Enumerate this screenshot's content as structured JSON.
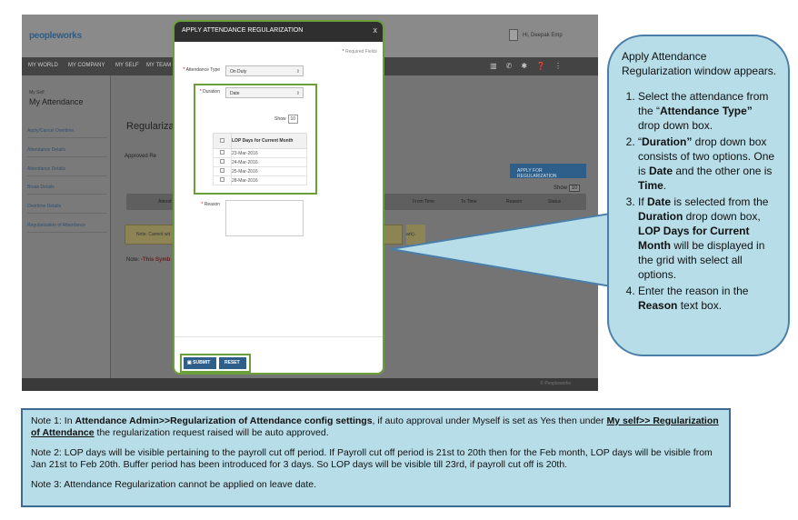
{
  "app": {
    "logo": "peopleworks",
    "user_name": "Hi, Deepak Emp",
    "nav": [
      "MY WORLD",
      "MY COMPANY",
      "MY SELF",
      "MY TEAM"
    ],
    "sidebar_self": "My Self",
    "sidebar_title": "My Attendance",
    "sidebar_items": [
      "Apply/Cancel Overtime",
      "Attendance Details",
      "Attendance Details",
      "Break Details",
      "Overtime Details",
      "Regularization of Attendance"
    ],
    "page_title": "Regularizatio",
    "legend": "Approved  Re",
    "apply_button": "APPLY FOR REGULARIZATION",
    "show_label": "Show",
    "show_value": "10",
    "table_headers": [
      "Attend",
      "From Time",
      "To Time",
      "Reason",
      "Status"
    ],
    "notice_text": "Note: Cannot wit",
    "notice_tail": "ark).",
    "note_line_prefix": "Note:",
    "note_line_red": "-This Symb",
    "footer_text": "© Peopleworks"
  },
  "dialog": {
    "title": "APPLY ATTENDANCE REGULARIZATION",
    "close": "x",
    "required_fields": "Required Fields",
    "attendance_type_label": "Attendance Type",
    "attendance_type_value": "On Duty",
    "duration_label": "Duration",
    "duration_value": "Date",
    "show_label": "Show",
    "show_value": "10",
    "lop_header": "LOP Days for Current Month",
    "lop_days": [
      "23-Mar-2016",
      "24-Mar-2016",
      "25-Mar-2016",
      "28-Mar-2016"
    ],
    "reason_label": "Reason",
    "submit": "SUBMIT",
    "reset": "RESET"
  },
  "callout": {
    "intro": "Apply Attendance Regularization window appears."
  },
  "notes": {
    "note1_plain_a": "Note 1: In ",
    "note1_bold_a": "Attendance Admin>>Regularization of Attendance config settings",
    "note1_plain_b": ", if auto approval under Myself is set as Yes then under ",
    "note1_bold_b": "My self>> Regularization of Attendance",
    "note1_plain_c": " the regularization request raised will be auto approved.",
    "note2": "Note 2: LOP days will be visible pertaining to the payroll cut off period. If Payroll cut off period is 21st to 20th then for the Feb month, LOP days will be visible from Jan 21st to Feb 20th. Buffer period has been introduced for 3 days. So LOP days will be visible till 23rd, if payroll cut off is 20th.",
    "note3": "Note 3: Attendance Regularization cannot be applied on leave date."
  },
  "colors": {
    "highlight_green": "#6aa03a",
    "callout_fill": "#b7dde8",
    "button_blue": "#2e5f8a"
  }
}
